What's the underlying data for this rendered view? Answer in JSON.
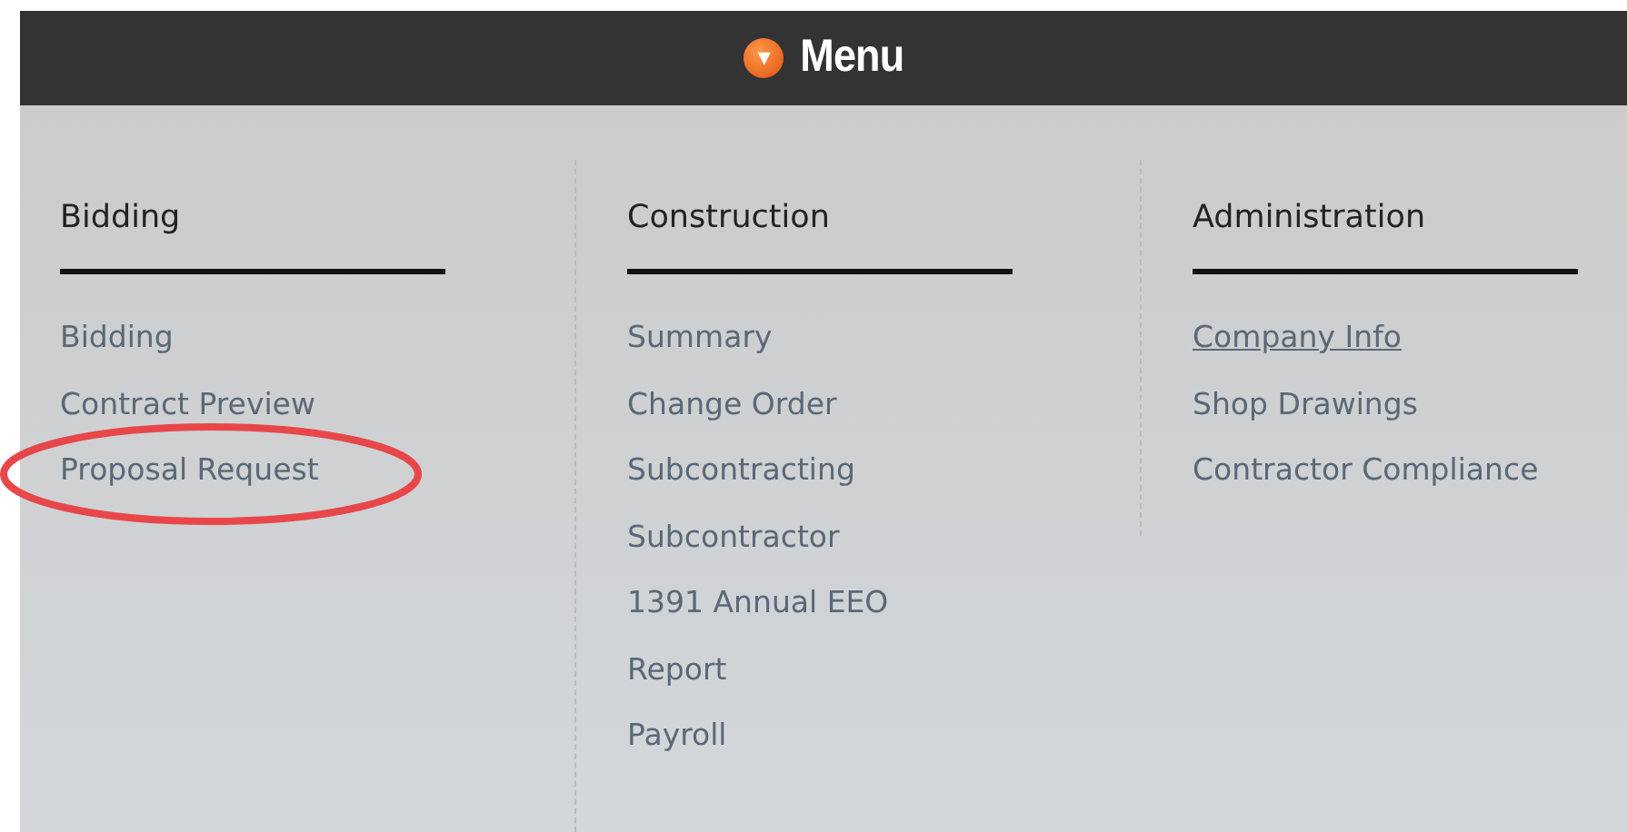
{
  "header": {
    "icon": "▾",
    "title": "Menu"
  },
  "columns": [
    {
      "heading": "Bidding",
      "items": [
        {
          "label": "Bidding",
          "hovered": false,
          "circled": false
        },
        {
          "label": "Contract Preview",
          "hovered": false,
          "circled": false
        },
        {
          "label": "Proposal Request",
          "hovered": false,
          "circled": true
        }
      ]
    },
    {
      "heading": "Construction",
      "items": [
        {
          "label": "Summary",
          "hovered": false,
          "circled": false
        },
        {
          "label": "Change Order",
          "hovered": false,
          "circled": false
        },
        {
          "label": "Subcontracting",
          "hovered": false,
          "circled": false
        },
        {
          "label": "Subcontractor",
          "hovered": false,
          "circled": false
        },
        {
          "label": "1391 Annual EEO",
          "hovered": false,
          "circled": false
        },
        {
          "label": "Report",
          "hovered": false,
          "circled": false
        },
        {
          "label": "Payroll",
          "hovered": false,
          "circled": false
        }
      ]
    },
    {
      "heading": "Administration",
      "items": [
        {
          "label": "Company Info",
          "hovered": true,
          "circled": false
        },
        {
          "label": "Shop Drawings",
          "hovered": false,
          "circled": false
        },
        {
          "label": "Contractor Compliance",
          "hovered": false,
          "circled": false
        }
      ]
    }
  ]
}
